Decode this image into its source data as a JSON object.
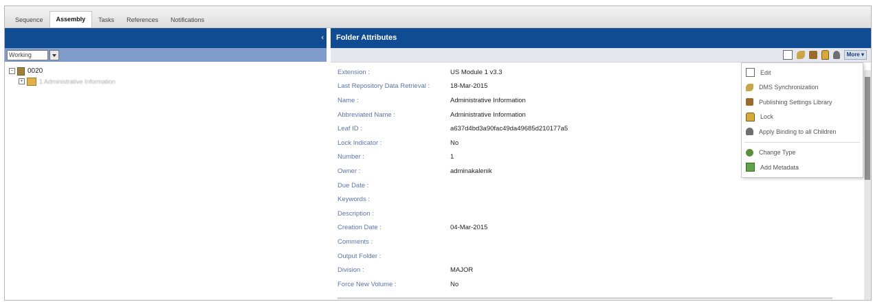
{
  "tabs": [
    "Sequence",
    "Assembly",
    "Tasks",
    "References",
    "Notifications"
  ],
  "active_tab": "Assembly",
  "left": {
    "collapse_glyph": "‹",
    "filter_value": "Working",
    "tree": {
      "root_label": "0020",
      "child_label": "1 Administrative Information"
    }
  },
  "right": {
    "title": "Folder Attributes",
    "more_label": "More ▾",
    "attributes": [
      {
        "label": "Extension :",
        "value": "US Module 1 v3.3"
      },
      {
        "label": "Last Repository Data Retrieval :",
        "value": "18-Mar-2015"
      },
      {
        "label": "Name :",
        "value": "Administrative Information"
      },
      {
        "label": "Abbreviated Name :",
        "value": "Administrative Information"
      },
      {
        "label": "Leaf ID :",
        "value": "a637d4bd3a90fac49da49685d210177a5"
      },
      {
        "label": "Lock Indicator :",
        "value": "No"
      },
      {
        "label": "Number :",
        "value": "1"
      },
      {
        "label": "Owner :",
        "value": "adminakalenik"
      },
      {
        "label": "Due Date :",
        "value": ""
      },
      {
        "label": "Keywords :",
        "value": ""
      },
      {
        "label": "Description :",
        "value": ""
      },
      {
        "label": "Creation Date :",
        "value": "04-Mar-2015"
      },
      {
        "label": "Comments :",
        "value": ""
      },
      {
        "label": "Output Folder :",
        "value": ""
      },
      {
        "label": "Division :",
        "value": "MAJOR"
      },
      {
        "label": "Force New Volume :",
        "value": "No"
      }
    ]
  },
  "menu": {
    "items": [
      {
        "label": "Edit",
        "icon": "edit-icon"
      },
      {
        "label": "DMS Synchronization",
        "icon": "sync-icon"
      },
      {
        "label": "Publishing Settings Library",
        "icon": "publishing-icon"
      },
      {
        "label": "Lock",
        "icon": "lock-icon"
      },
      {
        "label": "Apply Binding to all Children",
        "icon": "binding-icon"
      },
      {
        "label": "Change Type",
        "icon": "change-type-icon"
      },
      {
        "label": "Add Metadata",
        "icon": "add-metadata-icon"
      }
    ]
  },
  "colors": {
    "header_blue": "#0f4c91",
    "toolbar_blue": "#7f9bca",
    "label_blue": "#5b74a8"
  }
}
